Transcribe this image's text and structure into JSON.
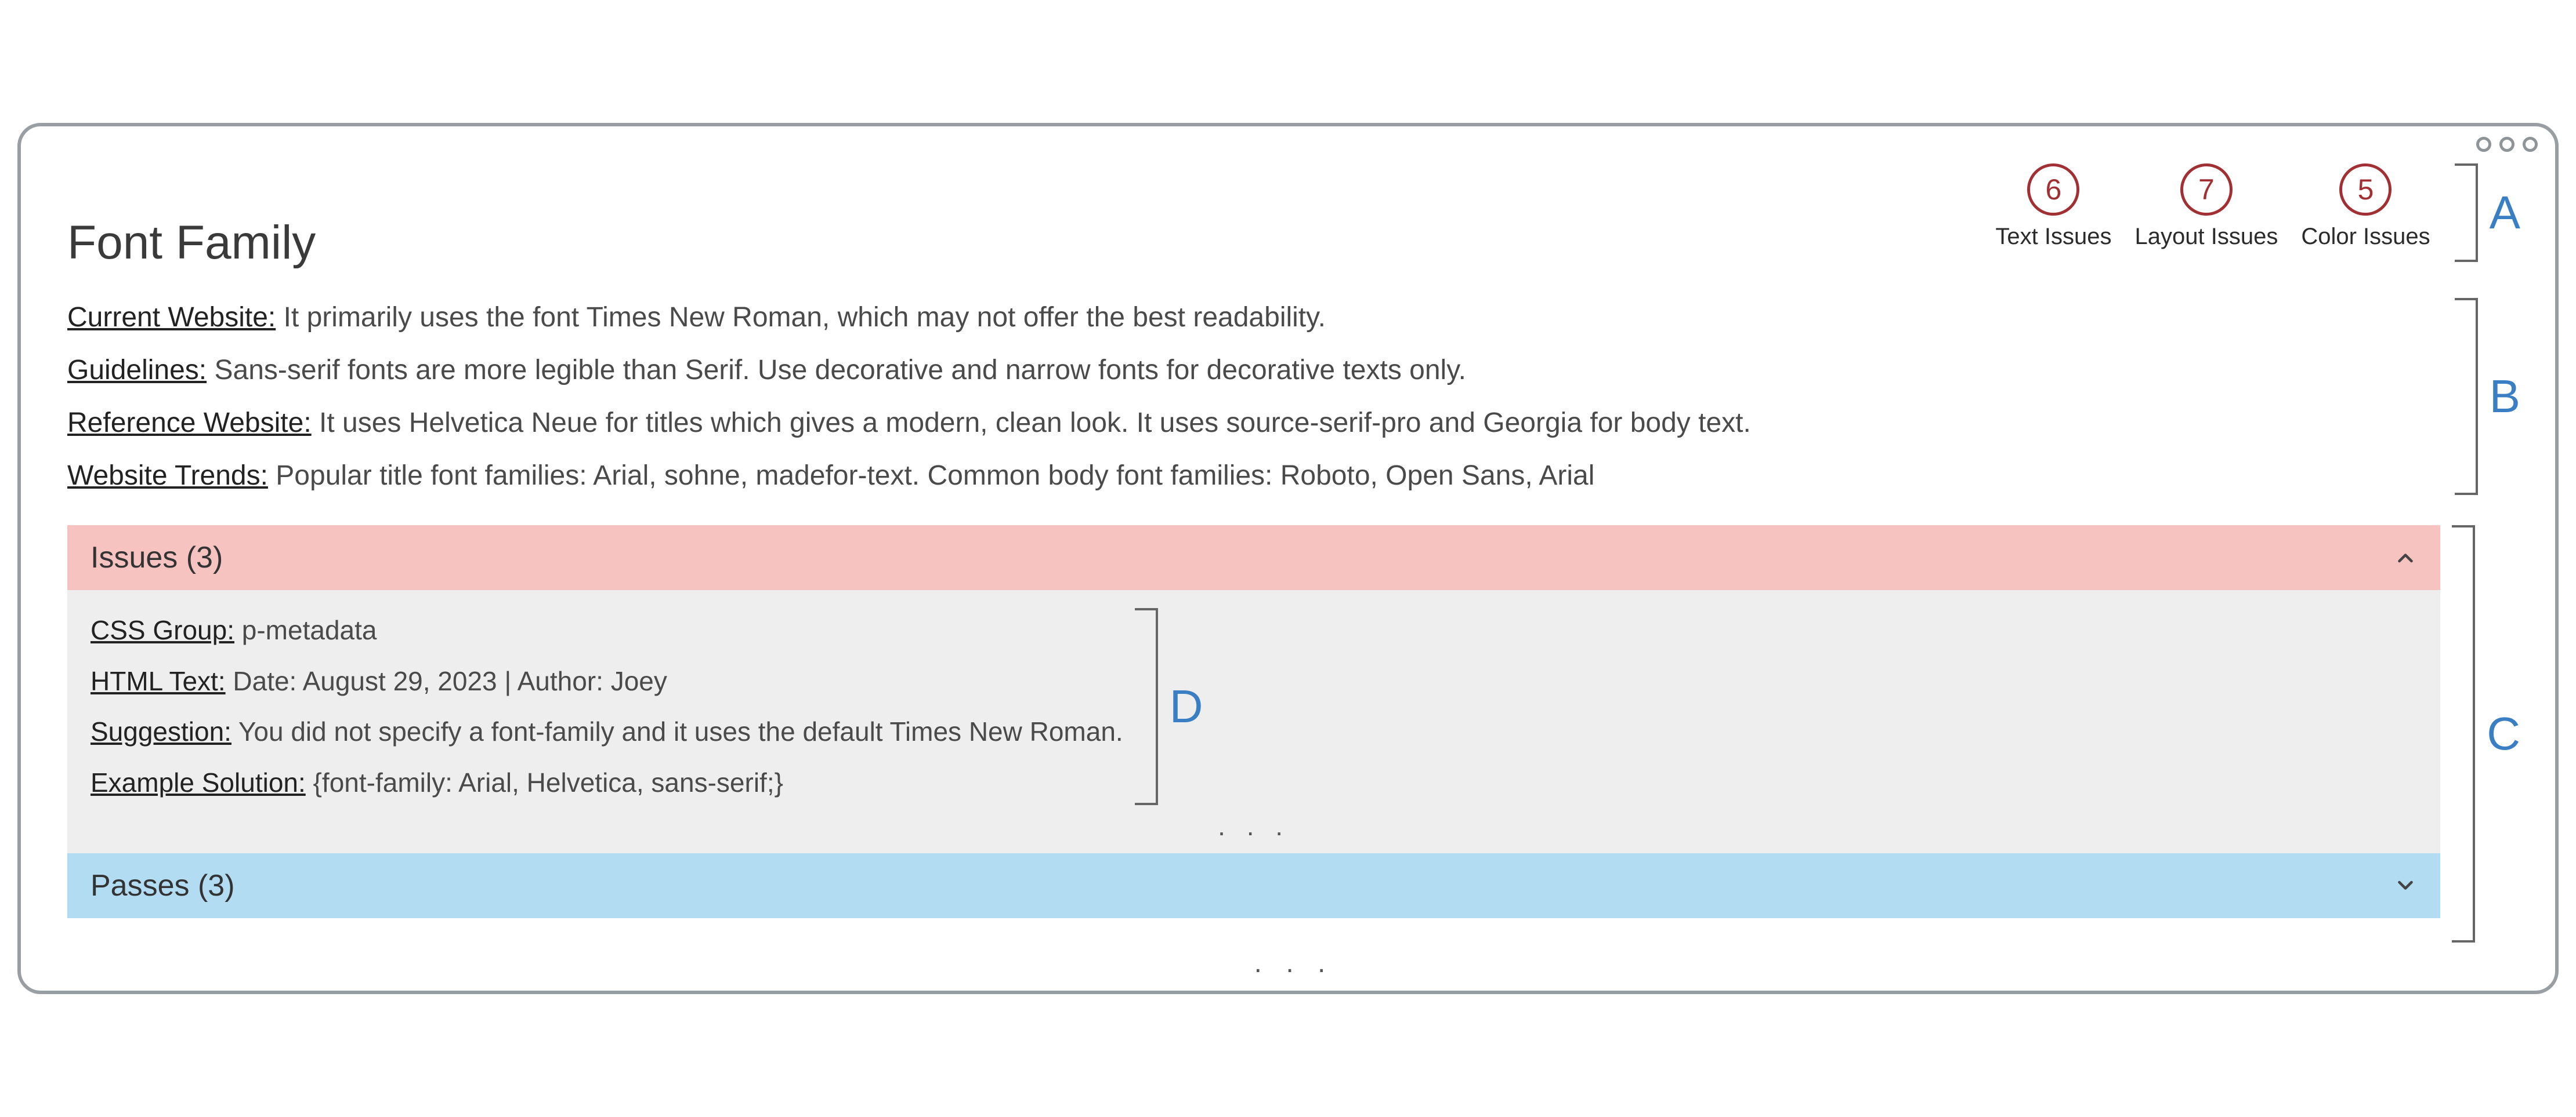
{
  "title": "Font Family",
  "summary": {
    "items": [
      {
        "count": "6",
        "label": "Text Issues"
      },
      {
        "count": "7",
        "label": "Layout Issues"
      },
      {
        "count": "5",
        "label": "Color Issues"
      }
    ]
  },
  "annotations": {
    "a": "A",
    "b": "B",
    "c": "C",
    "d": "D"
  },
  "info": {
    "current_website": {
      "label": "Current Website:",
      "text": "It primarily uses the font Times New Roman, which may not offer the best readability."
    },
    "guidelines": {
      "label": "Guidelines:",
      "text": "Sans-serif fonts are more legible than Serif. Use decorative and narrow fonts for decorative texts only."
    },
    "reference_website": {
      "label": "Reference Website:",
      "text": "It uses Helvetica Neue for titles which gives a modern, clean look. It uses source-serif-pro and Georgia for body text."
    },
    "website_trends": {
      "label": "Website Trends:",
      "text": "Popular title font families: Arial, sohne, madefor-text. Common body font families: Roboto, Open Sans, Arial"
    }
  },
  "accordion": {
    "issues_header": "Issues (3)",
    "passes_header": "Passes (3)"
  },
  "issue_detail": {
    "css_group": {
      "label": "CSS Group:",
      "text": "p-metadata"
    },
    "html_text": {
      "label": "HTML Text:",
      "text": "Date: August 29, 2023 | Author: Joey"
    },
    "suggestion": {
      "label": "Suggestion:",
      "text": "You did not specify a font-family and it uses the default Times New Roman."
    },
    "example_solution": {
      "label": "Example Solution:",
      "text": "{font-family: Arial, Helvetica, sans-serif;}"
    }
  },
  "ellipsis": ". . .",
  "bottom_ellipsis": ". . ."
}
